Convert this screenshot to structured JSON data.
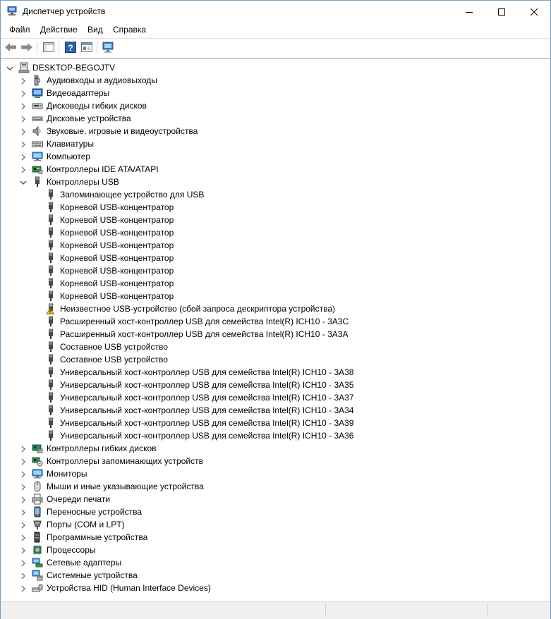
{
  "window": {
    "title": "Диспетчер устройств"
  },
  "menu": [
    "Файл",
    "Действие",
    "Вид",
    "Справка"
  ],
  "tree": [
    {
      "label": "DESKTOP-BEGOJTV",
      "level": 0,
      "expander": "open",
      "icon": "computer-icon"
    },
    {
      "label": "Аудиовходы и аудиовыходы",
      "level": 1,
      "expander": "closed",
      "icon": "audio-io-icon"
    },
    {
      "label": "Видеоадаптеры",
      "level": 1,
      "expander": "closed",
      "icon": "display-adapter-icon"
    },
    {
      "label": "Дисководы гибких дисков",
      "level": 1,
      "expander": "closed",
      "icon": "floppy-drive-icon"
    },
    {
      "label": "Дисковые устройства",
      "level": 1,
      "expander": "closed",
      "icon": "disk-drive-icon"
    },
    {
      "label": "Звуковые, игровые и видеоустройства",
      "level": 1,
      "expander": "closed",
      "icon": "speaker-icon"
    },
    {
      "label": "Клавиатуры",
      "level": 1,
      "expander": "closed",
      "icon": "keyboard-icon"
    },
    {
      "label": "Компьютер",
      "level": 1,
      "expander": "closed",
      "icon": "monitor-icon"
    },
    {
      "label": "Контроллеры IDE ATA/ATAPI",
      "level": 1,
      "expander": "closed",
      "icon": "ide-controller-icon"
    },
    {
      "label": "Контроллеры USB",
      "level": 1,
      "expander": "open",
      "icon": "usb-icon"
    },
    {
      "label": "Запоминающее устройство для USB",
      "level": 2,
      "expander": "none",
      "icon": "usb-icon"
    },
    {
      "label": "Корневой USB-концентратор",
      "level": 2,
      "expander": "none",
      "icon": "usb-icon"
    },
    {
      "label": "Корневой USB-концентратор",
      "level": 2,
      "expander": "none",
      "icon": "usb-icon"
    },
    {
      "label": "Корневой USB-концентратор",
      "level": 2,
      "expander": "none",
      "icon": "usb-icon"
    },
    {
      "label": "Корневой USB-концентратор",
      "level": 2,
      "expander": "none",
      "icon": "usb-icon"
    },
    {
      "label": "Корневой USB-концентратор",
      "level": 2,
      "expander": "none",
      "icon": "usb-icon"
    },
    {
      "label": "Корневой USB-концентратор",
      "level": 2,
      "expander": "none",
      "icon": "usb-icon"
    },
    {
      "label": "Корневой USB-концентратор",
      "level": 2,
      "expander": "none",
      "icon": "usb-icon"
    },
    {
      "label": "Корневой USB-концентратор",
      "level": 2,
      "expander": "none",
      "icon": "usb-icon"
    },
    {
      "label": "Неизвестное USB-устройство (сбой запроса дескриптора устройства)",
      "level": 2,
      "expander": "none",
      "icon": "usb-warning-icon"
    },
    {
      "label": "Расширенный хост-контроллер USB для семейства Intel(R) ICH10 - 3A3C",
      "level": 2,
      "expander": "none",
      "icon": "usb-icon"
    },
    {
      "label": "Расширенный хост-контроллер USB для семейства Intel(R) ICH10 - 3A3A",
      "level": 2,
      "expander": "none",
      "icon": "usb-icon"
    },
    {
      "label": "Составное USB устройство",
      "level": 2,
      "expander": "none",
      "icon": "usb-icon"
    },
    {
      "label": "Составное USB устройство",
      "level": 2,
      "expander": "none",
      "icon": "usb-icon"
    },
    {
      "label": "Универсальный хост-контроллер USB для семейства Intel(R) ICH10 - 3A38",
      "level": 2,
      "expander": "none",
      "icon": "usb-icon"
    },
    {
      "label": "Универсальный хост-контроллер USB для семейства Intel(R) ICH10 - 3A35",
      "level": 2,
      "expander": "none",
      "icon": "usb-icon"
    },
    {
      "label": "Универсальный хост-контроллер USB для семейства Intel(R) ICH10 - 3A37",
      "level": 2,
      "expander": "none",
      "icon": "usb-icon"
    },
    {
      "label": "Универсальный хост-контроллер USB для семейства Intel(R) ICH10 - 3A34",
      "level": 2,
      "expander": "none",
      "icon": "usb-icon"
    },
    {
      "label": "Универсальный хост-контроллер USB для семейства Intel(R) ICH10 - 3A39",
      "level": 2,
      "expander": "none",
      "icon": "usb-icon"
    },
    {
      "label": "Универсальный хост-контроллер USB для семейства Intel(R) ICH10 - 3A36",
      "level": 2,
      "expander": "none",
      "icon": "usb-icon"
    },
    {
      "label": "Контроллеры гибких дисков",
      "level": 1,
      "expander": "closed",
      "icon": "floppy-controller-icon"
    },
    {
      "label": "Контроллеры запоминающих устройств",
      "level": 1,
      "expander": "closed",
      "icon": "storage-controller-icon"
    },
    {
      "label": "Мониторы",
      "level": 1,
      "expander": "closed",
      "icon": "monitor-icon"
    },
    {
      "label": "Мыши и иные указывающие устройства",
      "level": 1,
      "expander": "closed",
      "icon": "mouse-icon"
    },
    {
      "label": "Очереди печати",
      "level": 1,
      "expander": "closed",
      "icon": "printer-icon"
    },
    {
      "label": "Переносные устройства",
      "level": 1,
      "expander": "closed",
      "icon": "portable-device-icon"
    },
    {
      "label": "Порты (COM и LPT)",
      "level": 1,
      "expander": "closed",
      "icon": "port-icon"
    },
    {
      "label": "Программные устройства",
      "level": 1,
      "expander": "closed",
      "icon": "software-device-icon"
    },
    {
      "label": "Процессоры",
      "level": 1,
      "expander": "closed",
      "icon": "processor-icon"
    },
    {
      "label": "Сетевые адаптеры",
      "level": 1,
      "expander": "closed",
      "icon": "network-adapter-icon"
    },
    {
      "label": "Системные устройства",
      "level": 1,
      "expander": "closed",
      "icon": "system-device-icon"
    },
    {
      "label": "Устройства HID (Human Interface Devices)",
      "level": 1,
      "expander": "closed",
      "icon": "hid-icon"
    }
  ]
}
